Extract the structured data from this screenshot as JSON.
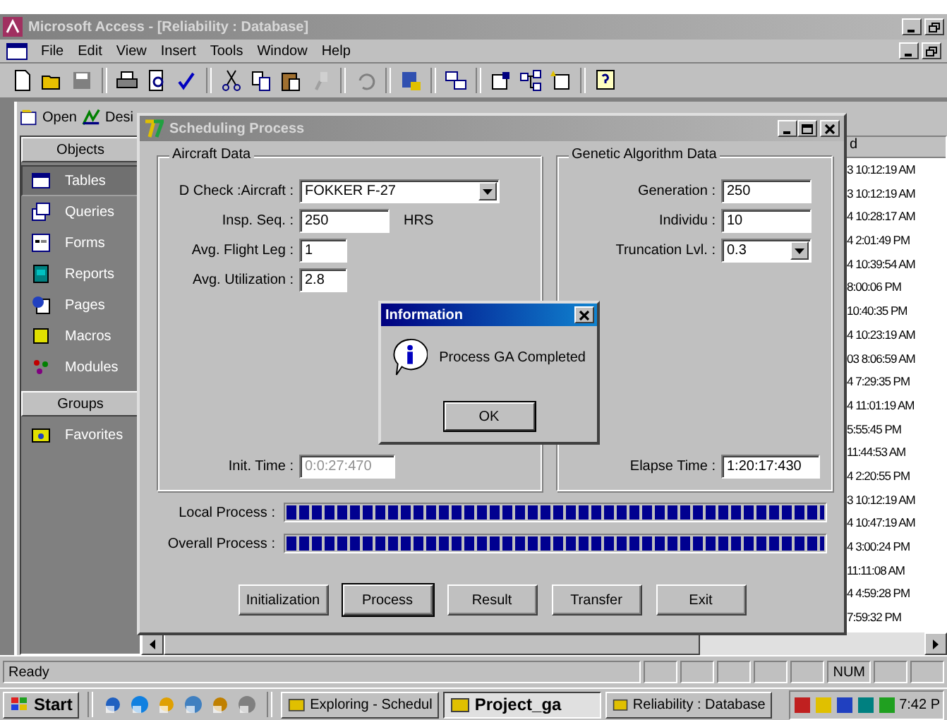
{
  "window": {
    "title": "Microsoft Access - [Reliability : Database]"
  },
  "menu": [
    {
      "label": "File"
    },
    {
      "label": "Edit"
    },
    {
      "label": "View"
    },
    {
      "label": "Insert"
    },
    {
      "label": "Tools"
    },
    {
      "label": "Window"
    },
    {
      "label": "Help"
    }
  ],
  "db_toolbar": [
    {
      "label": "Open",
      "kind": "open"
    },
    {
      "label": "Desi",
      "kind": "design"
    }
  ],
  "sidebar": {
    "sections": [
      {
        "header": "Objects",
        "items": [
          {
            "label": "Tables",
            "kind": "table",
            "selected": true
          },
          {
            "label": "Queries",
            "kind": "query",
            "selected": false
          },
          {
            "label": "Forms",
            "kind": "form",
            "selected": false
          },
          {
            "label": "Reports",
            "kind": "report",
            "selected": false
          },
          {
            "label": "Pages",
            "kind": "page",
            "selected": false
          },
          {
            "label": "Macros",
            "kind": "macro",
            "selected": false
          },
          {
            "label": "Modules",
            "kind": "module",
            "selected": false
          }
        ]
      },
      {
        "header": "Groups",
        "items": [
          {
            "label": "Favorites",
            "kind": "folder",
            "selected": false
          }
        ]
      }
    ]
  },
  "list": {
    "header": "d",
    "rows": [
      "3 10:12:19 AM",
      "3 10:12:19 AM",
      "4 10:28:17 AM",
      "4 2:01:49 PM",
      "4 10:39:54 AM",
      "8:00:06 PM",
      "10:40:35 PM",
      "4 10:23:19 AM",
      "03 8:06:59 AM",
      "4 7:29:35 PM",
      "4 11:01:19 AM",
      "5:55:45 PM",
      "11:44:53 AM",
      "4 2:20:55 PM",
      "3 10:12:19 AM",
      "4 10:47:19 AM",
      "4 3:00:24 PM",
      "11:11:08 AM",
      "4 4:59:28 PM",
      "7:59:32 PM"
    ]
  },
  "dialog": {
    "title": "Scheduling Process",
    "groups": [
      {
        "title": "Aircraft Data",
        "fields": [
          {
            "label": "D Check :Aircraft :",
            "value": "FOKKER F-27",
            "kind": "combo"
          },
          {
            "label": "Insp. Seq. :",
            "value": "250",
            "kind": "text",
            "unit": "HRS"
          },
          {
            "label": "Avg. Flight Leg :",
            "value": "1",
            "kind": "short"
          },
          {
            "label": "Avg. Utilization :",
            "value": "2.8",
            "kind": "short"
          }
        ],
        "footer": {
          "label": "Init. Time :",
          "value": "0:0:27:470",
          "disabled": true
        }
      },
      {
        "title": "Genetic Algorithm Data",
        "fields": [
          {
            "label": "Generation :",
            "value": "250",
            "kind": "text"
          },
          {
            "label": "Individu :",
            "value": "10",
            "kind": "text"
          },
          {
            "label": "Truncation Lvl. :",
            "value": "0.3",
            "kind": "combo"
          }
        ],
        "footer": {
          "label": "Elapse Time :",
          "value": "1:20:17:430",
          "disabled": false
        }
      }
    ],
    "progress": [
      {
        "label": "Local Process :",
        "level": 1
      },
      {
        "label": "Overall Process :",
        "level": 1
      }
    ],
    "buttons": [
      {
        "label": "Initialization",
        "selected": false
      },
      {
        "label": "Process",
        "selected": true
      },
      {
        "label": "Result",
        "selected": false
      },
      {
        "label": "Transfer",
        "selected": false
      },
      {
        "label": "Exit",
        "selected": false
      }
    ]
  },
  "info_dialog": {
    "title": "Information",
    "message": "Process GA Completed",
    "button": "OK"
  },
  "status_bar": {
    "text": "Ready",
    "indicators": [
      "NUM"
    ]
  },
  "taskbar": {
    "start": "Start",
    "tasks": [
      {
        "label": "Exploring - Schedul",
        "selected": false
      },
      {
        "label": "Project_ga",
        "selected": true
      },
      {
        "label": "Reliability : Database",
        "selected": false
      }
    ],
    "clock": "7:42 P"
  }
}
